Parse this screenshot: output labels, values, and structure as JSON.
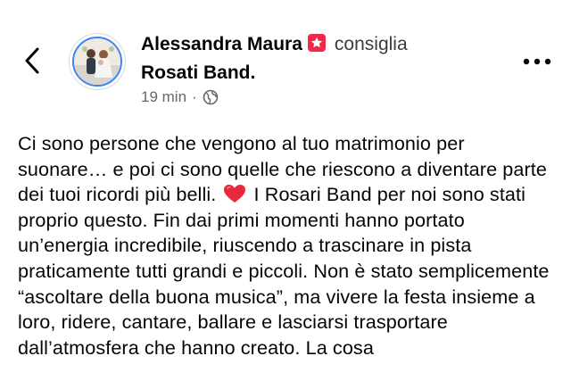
{
  "post": {
    "author": "Alessandra Maura",
    "action": "consiglia",
    "page_name": "Rosati Band.",
    "time": "19 min",
    "separator": "·",
    "body_before_heart": "Ci sono persone che vengono al tuo matrimonio per suonare… e poi ci sono quelle che riescono a diventare parte dei tuoi ricordi più belli. ",
    "body_after_heart": " I Rosari Band per noi sono stati proprio questo. Fin dai primi momenti hanno portato un’energia incredibile, riuscendo a trascinare in pista praticamente tutti grandi e piccoli. Non è stato semplicemente “ascoltare della buona musica”, ma vivere la festa insieme a loro, ridere, cantare, ballare e lasciarsi trasportare dall’atmosfera che hanno creato. La cosa"
  },
  "icons": {
    "back": "chevron-left-icon",
    "recommend": "recommend-star-icon",
    "privacy": "globe-icon",
    "more": "more-options-icon",
    "emoji": "red-heart-emoji"
  },
  "colors": {
    "recommend_badge": "#f0284a",
    "avatar_ring": "#3b83f6",
    "heart": "#e8283c",
    "meta_text": "#65676b"
  }
}
